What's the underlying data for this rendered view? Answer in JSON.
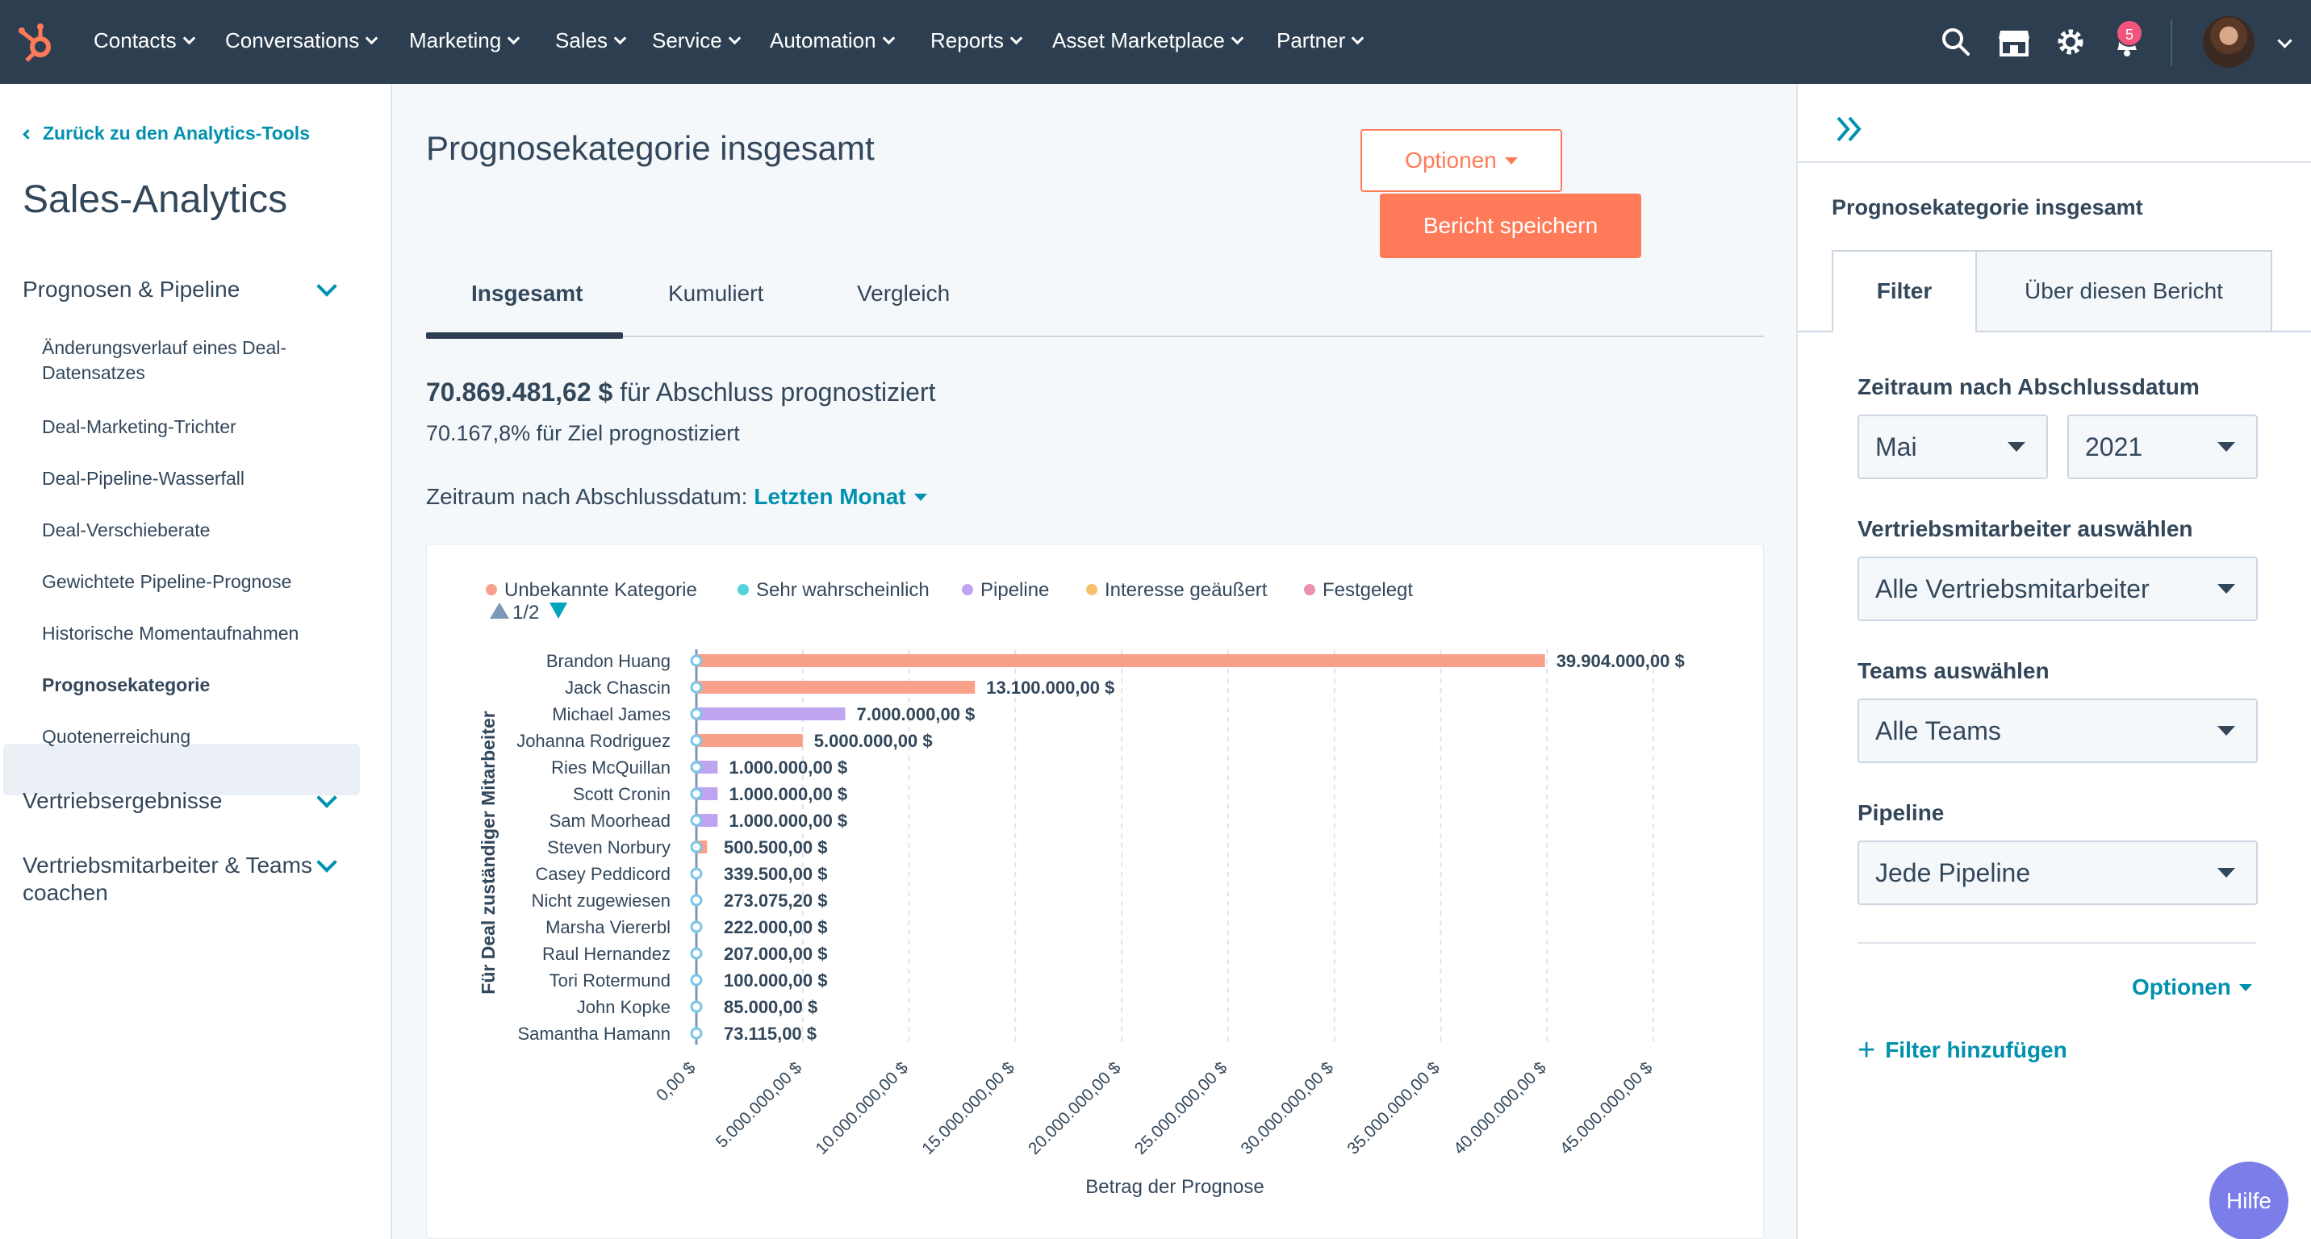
{
  "nav": {
    "items": [
      {
        "label": "Contacts"
      },
      {
        "label": "Conversations"
      },
      {
        "label": "Marketing"
      },
      {
        "label": "Sales"
      },
      {
        "label": "Service"
      },
      {
        "label": "Automation"
      },
      {
        "label": "Reports"
      },
      {
        "label": "Asset Marketplace"
      },
      {
        "label": "Partner"
      }
    ],
    "notification_count": "5",
    "icons": [
      "search-icon",
      "marketplace-icon",
      "settings-icon",
      "notifications-icon"
    ]
  },
  "sidebar": {
    "back_link": "Zurück zu den Analytics-Tools",
    "title": "Sales-Analytics",
    "sections": [
      {
        "label": "Prognosen & Pipeline"
      },
      {
        "label": "Vertriebsergebnisse"
      },
      {
        "label": "Vertriebsmitarbeiter & Teams coachen"
      }
    ],
    "items": [
      {
        "label": "Änderungsverlauf eines Deal-Datensatzes"
      },
      {
        "label": "Deal-Marketing-Trichter"
      },
      {
        "label": "Deal-Pipeline-Wasserfall"
      },
      {
        "label": "Deal-Verschieberate"
      },
      {
        "label": "Gewichtete Pipeline-Prognose"
      },
      {
        "label": "Historische Momentaufnahmen"
      },
      {
        "label": "Prognosekategorie"
      },
      {
        "label": "Quotenerreichung"
      }
    ]
  },
  "main": {
    "title": "Prognosekategorie insgesamt",
    "options_label": "Optionen",
    "save_label": "Bericht speichern",
    "tabs": [
      {
        "label": "Insgesamt"
      },
      {
        "label": "Kumuliert"
      },
      {
        "label": "Vergleich"
      }
    ],
    "summary_amount": "70.869.481,62 $",
    "summary_text": "für Abschluss prognostiziert",
    "summary_sub": "70.167,8% für Ziel prognostiziert",
    "range_label": "Zeitraum nach Abschlussdatum:",
    "range_value": "Letzten Monat"
  },
  "chart_data": {
    "type": "bar",
    "orientation": "horizontal",
    "stacked": true,
    "legend": [
      {
        "name": "Unbekannte Kategorie",
        "color": "#f8a08a"
      },
      {
        "name": "Sehr wahrscheinlich",
        "color": "#51d3d9"
      },
      {
        "name": "Pipeline",
        "color": "#bfa5f0"
      },
      {
        "name": "Interesse geäußert",
        "color": "#f5c26b"
      },
      {
        "name": "Festgelegt",
        "color": "#ea90b1"
      }
    ],
    "legend_page": "1/2",
    "categories": [
      "Brandon Huang",
      "Jack Chascin",
      "Michael James",
      "Johanna Rodriguez",
      "Ries McQuillan",
      "Scott Cronin",
      "Sam Moorhead",
      "Steven Norbury",
      "Casey Peddicord",
      "Nicht zugewiesen",
      "Marsha Viererbl",
      "Raul Hernandez",
      "Tori Rotermund",
      "John Kopke",
      "Samantha Hamann"
    ],
    "series": [
      {
        "name": "Unbekannte Kategorie",
        "values": [
          39904000,
          13100000,
          0,
          5000000,
          0,
          0,
          0,
          500500,
          0,
          0,
          0,
          0,
          0,
          0,
          0
        ]
      },
      {
        "name": "Pipeline",
        "values": [
          0,
          0,
          7000000,
          0,
          1000000,
          1000000,
          1000000,
          0,
          0,
          0,
          0,
          0,
          0,
          0,
          0
        ]
      }
    ],
    "data_labels": [
      "39.904.000,00 $",
      "13.100.000,00 $",
      "7.000.000,00 $",
      "5.000.000,00 $",
      "1.000.000,00 $",
      "1.000.000,00 $",
      "1.000.000,00 $",
      "500.500,00 $",
      "339.500,00 $",
      "273.075,20 $",
      "222.000,00 $",
      "207.000,00 $",
      "100.000,00 $",
      "85.000,00 $",
      "73.115,00 $"
    ],
    "xticks": [
      "0,00 $",
      "5.000.000,00 $",
      "10.000.000,00 $",
      "15.000.000,00 $",
      "20.000.000,00 $",
      "25.000.000,00 $",
      "30.000.000,00 $",
      "35.000.000,00 $",
      "40.000.000,00 $",
      "45.000.000,00 $"
    ],
    "xlim": [
      0,
      45000000
    ],
    "xlabel": "Betrag der Prognose",
    "ylabel": "Für Deal zuständiger Mitarbeiter",
    "grid": true
  },
  "filters": {
    "panel_title": "Prognosekategorie insgesamt",
    "tabs": [
      {
        "label": "Filter"
      },
      {
        "label": "Über diesen Bericht"
      }
    ],
    "date_label": "Zeitraum nach Abschlussdatum",
    "month": "Mai",
    "year": "2021",
    "rep_label": "Vertriebsmitarbeiter auswählen",
    "rep_value": "Alle Vertriebsmitarbeiter",
    "team_label": "Teams auswählen",
    "team_value": "Alle Teams",
    "pipeline_label": "Pipeline",
    "pipeline_value": "Jede Pipeline",
    "options_label": "Optionen",
    "add_filter_label": "Filter hinzufügen"
  },
  "help_label": "Hilfe",
  "colors": {
    "nav_bg": "#2d3e50",
    "accent": "#ff7a59",
    "link": "#0091ae"
  }
}
